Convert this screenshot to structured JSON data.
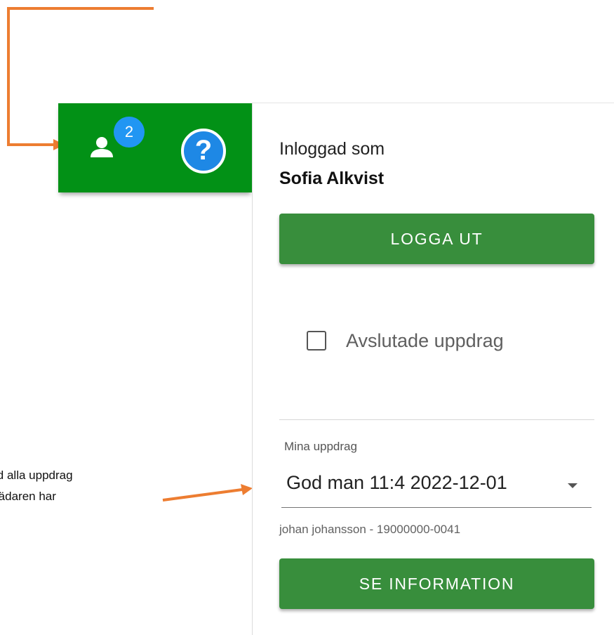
{
  "annotation": {
    "callout_lines": [
      "n med alla uppdrag",
      "företrädaren har"
    ],
    "arrow_color": "#ed7d31"
  },
  "toolbar": {
    "background": "#029116",
    "user_icon": "person-icon",
    "notification_count": "2",
    "help_icon": "help-circle-icon",
    "help_glyph": "?"
  },
  "panel": {
    "logged_in_label": "Inloggad som",
    "user_name": "Sofia Alkvist",
    "logout_label": "LOGGA UT",
    "checkbox": {
      "label": "Avslutade uppdrag",
      "checked": false
    },
    "assignments_select": {
      "label": "Mina uppdrag",
      "value": "God man 11:4 2022-12-01",
      "helper": "johan johansson - 19000000-0041"
    },
    "info_label": "SE INFORMATION"
  }
}
